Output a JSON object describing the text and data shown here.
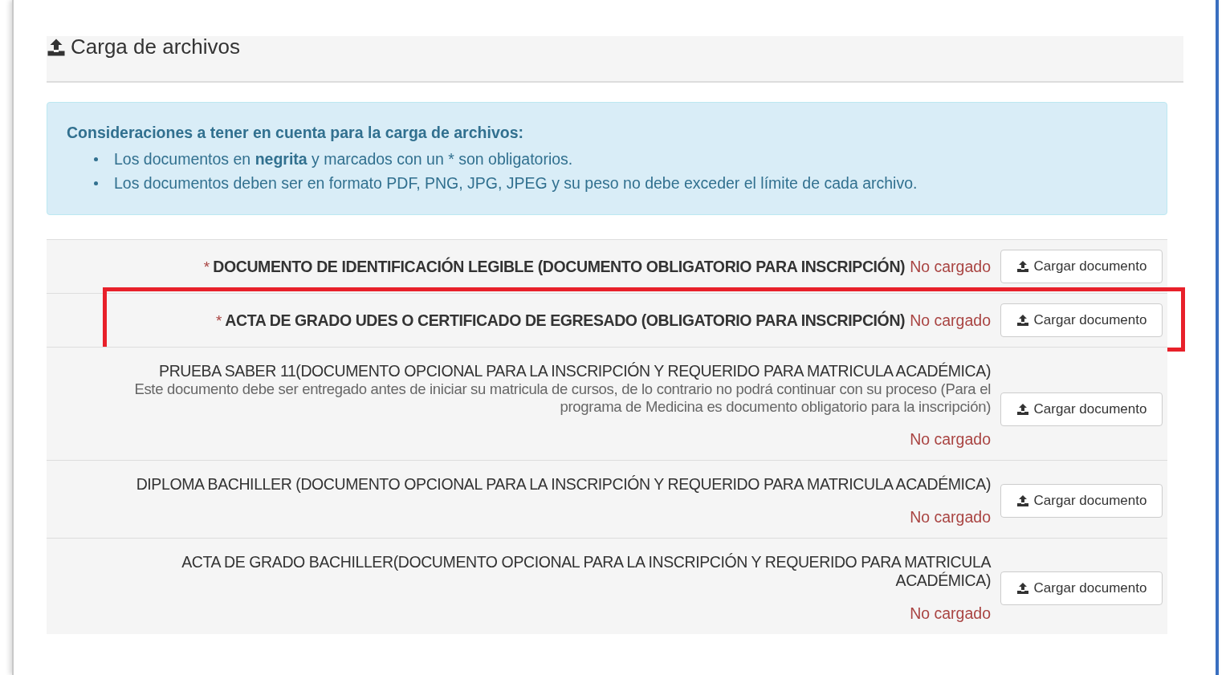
{
  "panel": {
    "title": "Carga de archivos"
  },
  "alert": {
    "title": "Consideraciones a tener en cuenta para la carga de archivos:",
    "items": [
      "Los documentos en **negrita** y marcados con un * son obligatorios.",
      "Los documentos deben ser en formato PDF, PNG, JPG, JPEG y su peso no debe exceder el límite de cada archivo."
    ]
  },
  "documents": [
    {
      "kind": "required",
      "marker": "*",
      "name": "DOCUMENTO DE IDENTIFICACIÓN LEGIBLE (DOCUMENTO OBLIGATORIO PARA INSCRIPCIÓN)",
      "status": "No cargado",
      "button": "Cargar documento",
      "highlighted": false
    },
    {
      "kind": "required",
      "marker": "*",
      "name": "ACTA DE GRADO UDES O CERTIFICADO DE EGRESADO (OBLIGATORIO PARA INSCRIPCIÓN)",
      "status": "No cargado",
      "button": "Cargar documento",
      "highlighted": true
    },
    {
      "kind": "optional",
      "name": "PRUEBA SABER 11(DOCUMENTO OPCIONAL PARA LA INSCRIPCIÓN Y REQUERIDO PARA MATRICULA ACADÉMICA)",
      "note": "Este documento debe ser entregado antes de iniciar su matricula de cursos, de lo contrario no podrá continuar con su proceso (Para el programa de Medicina es documento obligatorio para la inscripción)",
      "status": "No cargado",
      "button": "Cargar documento",
      "highlighted": false
    },
    {
      "kind": "optional",
      "name": "DIPLOMA BACHILLER (DOCUMENTO OPCIONAL PARA LA INSCRIPCIÓN Y REQUERIDO PARA MATRICULA ACADÉMICA)",
      "status": "No cargado",
      "button": "Cargar documento",
      "highlighted": false
    },
    {
      "kind": "optional",
      "name": "ACTA DE GRADO BACHILLER(DOCUMENTO OPCIONAL PARA LA INSCRIPCIÓN Y REQUERIDO PARA MATRICULA ACADÉMICA)",
      "status": "No cargado",
      "button": "Cargar documento",
      "highlighted": false
    }
  ]
}
